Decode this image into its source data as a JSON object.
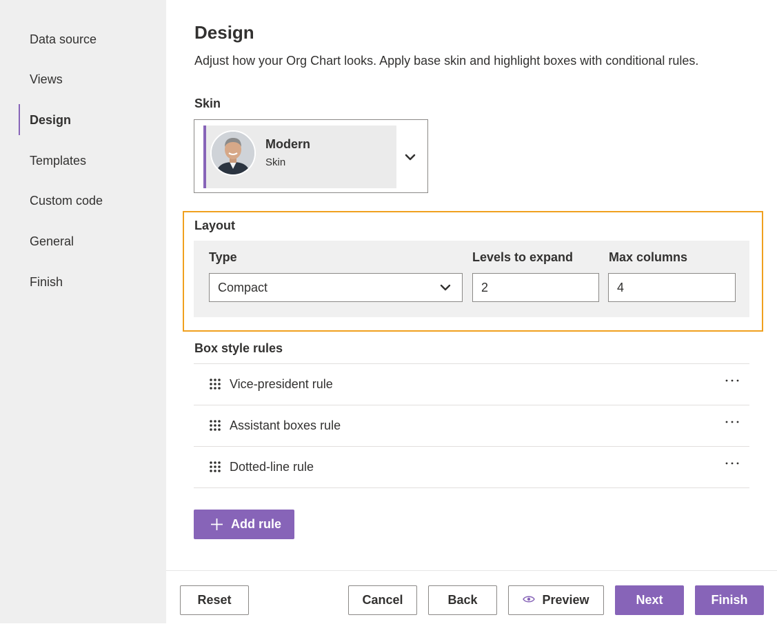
{
  "sidebar": {
    "items": [
      {
        "label": "Data source",
        "active": false
      },
      {
        "label": "Views",
        "active": false
      },
      {
        "label": "Design",
        "active": true
      },
      {
        "label": "Templates",
        "active": false
      },
      {
        "label": "Custom code",
        "active": false
      },
      {
        "label": "General",
        "active": false
      },
      {
        "label": "Finish",
        "active": false
      }
    ]
  },
  "page": {
    "title": "Design",
    "description": "Adjust how your Org Chart looks. Apply base skin and highlight boxes with conditional rules."
  },
  "skin": {
    "section_label": "Skin",
    "selected_name": "Modern",
    "selected_sub": "Skin",
    "avatar_icon": "person-photo",
    "chevron_icon": "chevron-down-icon"
  },
  "layout": {
    "section_label": "Layout",
    "type_label": "Type",
    "type_value": "Compact",
    "levels_label": "Levels to expand",
    "levels_value": "2",
    "max_columns_label": "Max columns",
    "max_columns_value": "4",
    "highlight_color": "#f0a01e"
  },
  "rules": {
    "section_label": "Box style rules",
    "items": [
      {
        "label": "Vice-president rule"
      },
      {
        "label": "Assistant boxes rule"
      },
      {
        "label": "Dotted-line rule"
      }
    ],
    "add_label": "Add rule"
  },
  "footer": {
    "reset": "Reset",
    "cancel": "Cancel",
    "back": "Back",
    "preview": "Preview",
    "next": "Next",
    "finish": "Finish"
  },
  "colors": {
    "accent": "#8764b8",
    "sidebar_bg": "#efefef"
  }
}
